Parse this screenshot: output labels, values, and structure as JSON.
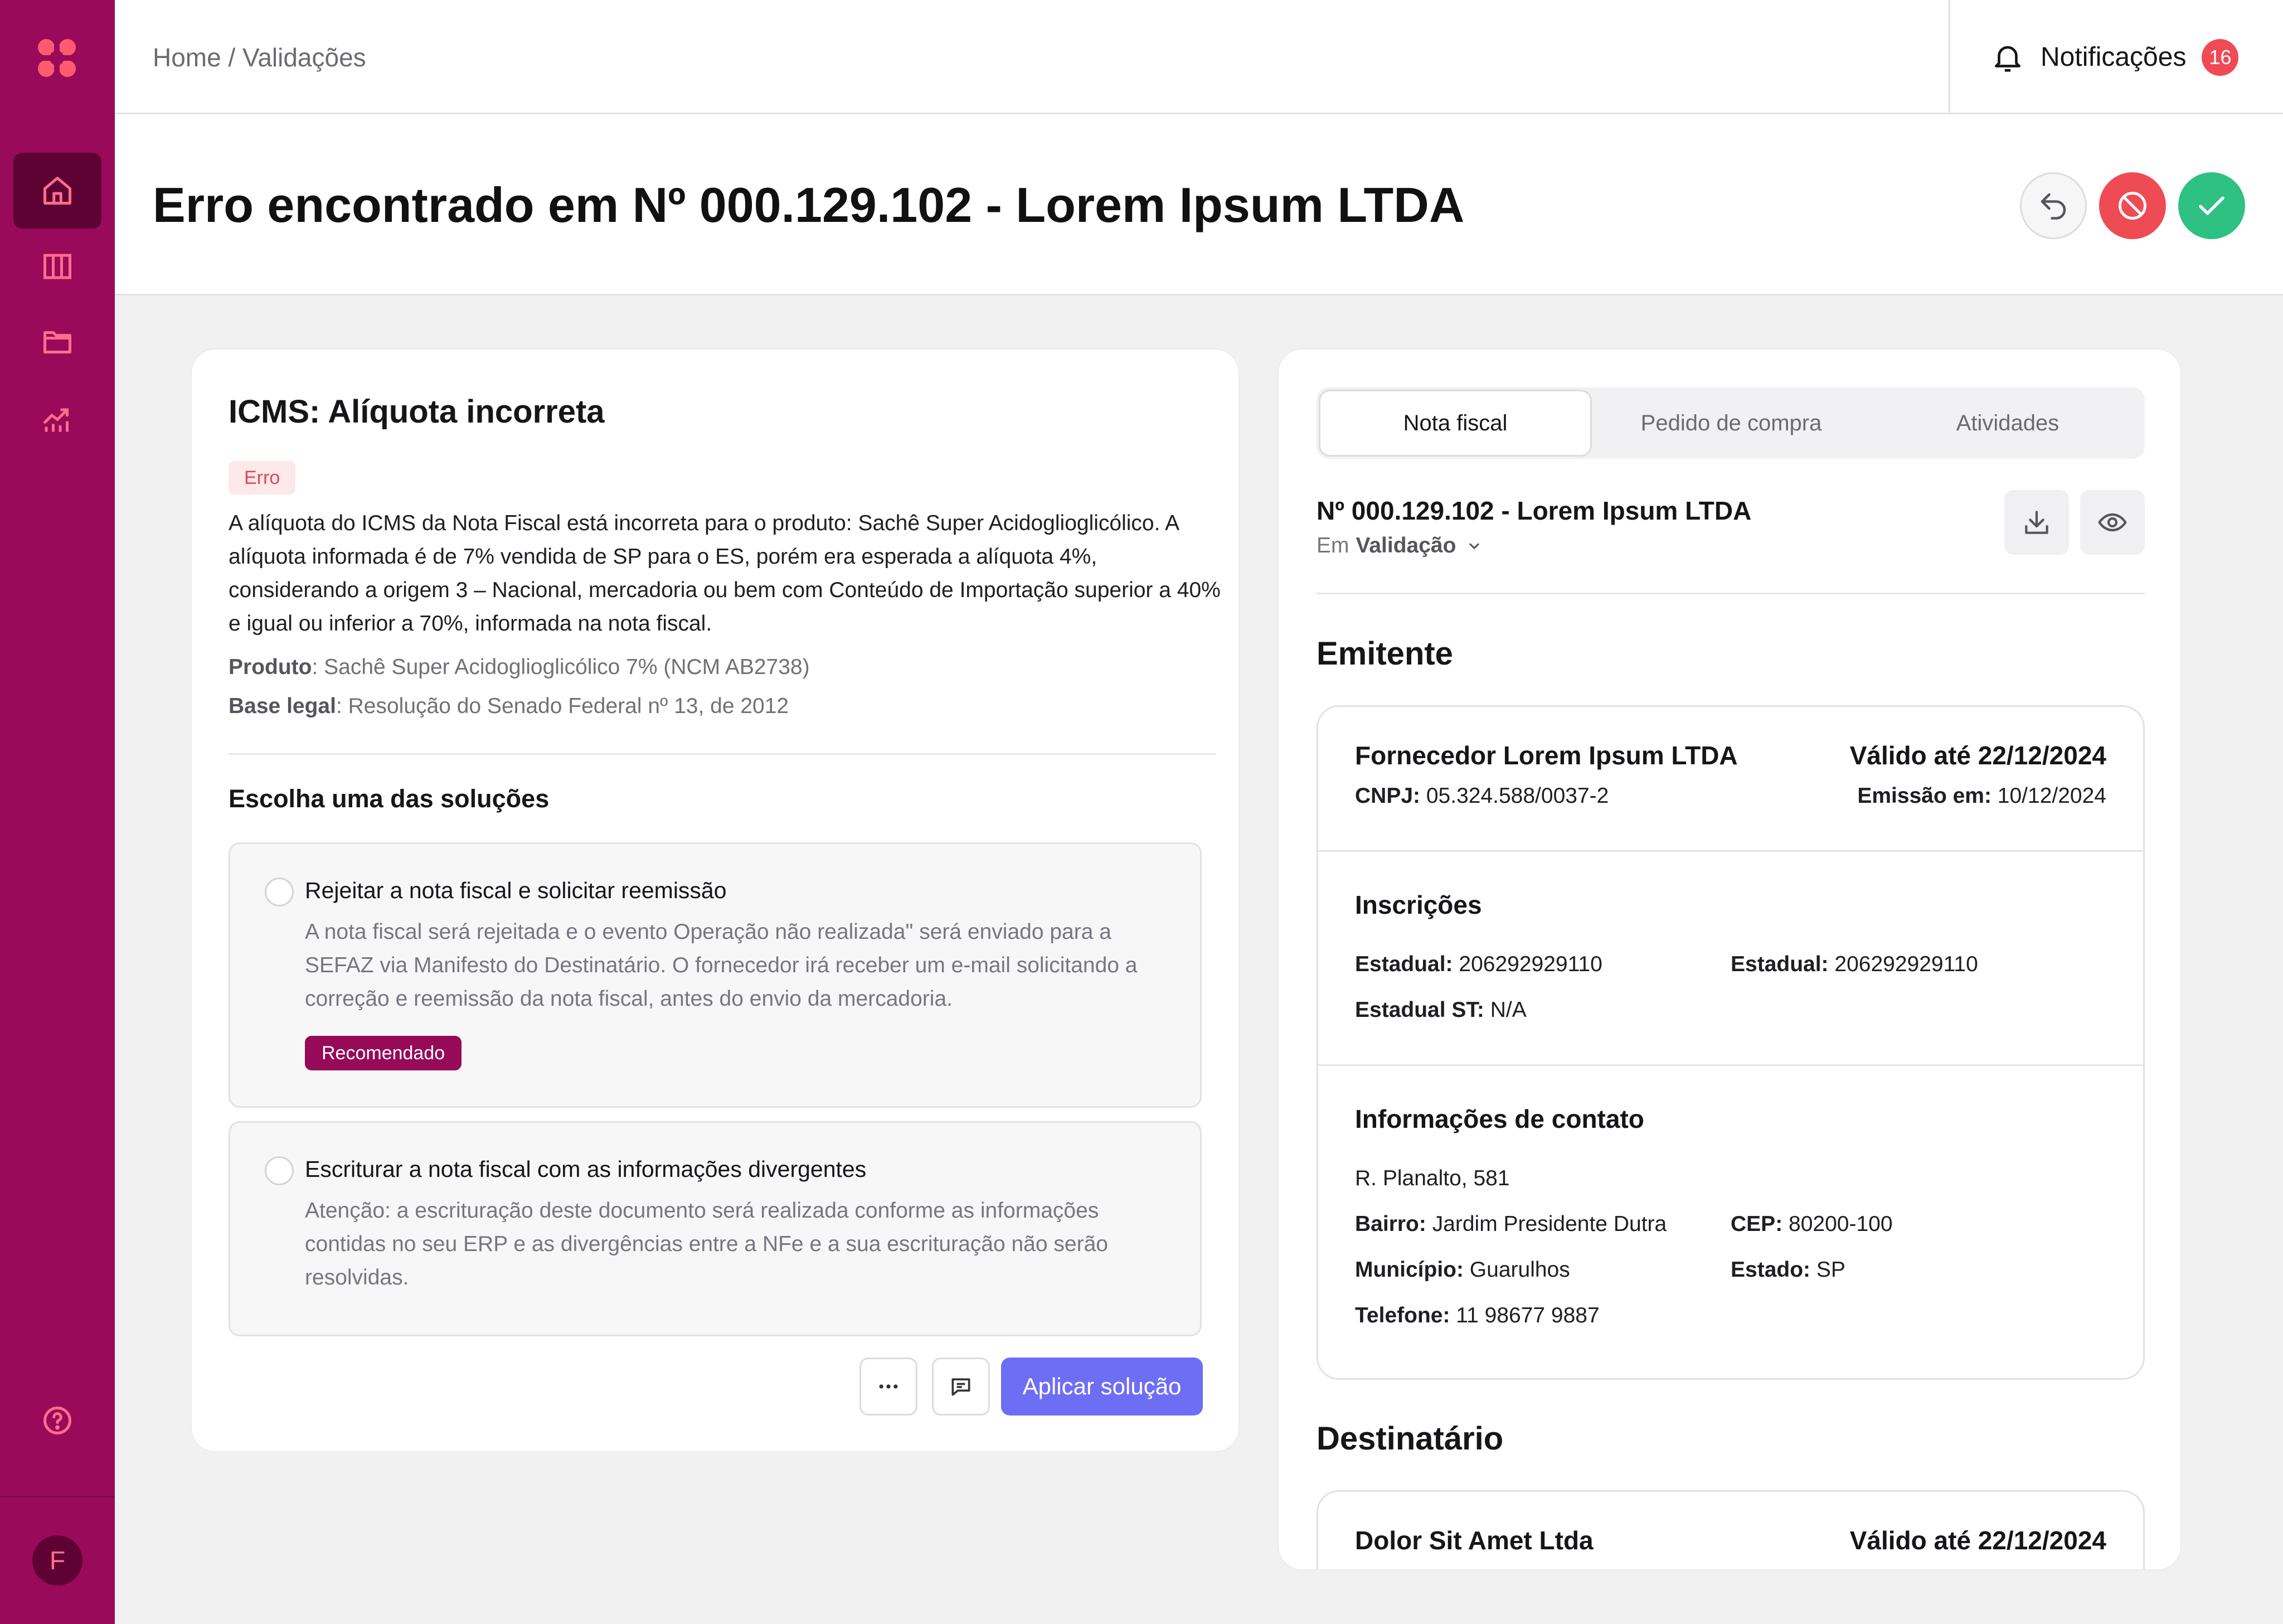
{
  "sidebar": {
    "items": [
      {
        "name": "home",
        "icon": "home-icon",
        "active": true
      },
      {
        "name": "columns",
        "icon": "columns-icon",
        "active": false
      },
      {
        "name": "folder",
        "icon": "folder-icon",
        "active": false
      },
      {
        "name": "analytics",
        "icon": "chart-icon",
        "active": false
      }
    ],
    "help_icon": "help-circle-icon",
    "avatar_initial": "F"
  },
  "topbar": {
    "breadcrumb": "Home / Validações",
    "notifications_label": "Notificações",
    "notifications_count": "16"
  },
  "header": {
    "title": "Erro encontrado em Nº 000.129.102 - Lorem Ipsum LTDA"
  },
  "error": {
    "title": "ICMS: Alíquota incorreta",
    "badge": "Erro",
    "description": "A alíquota do ICMS da Nota Fiscal está incorreta para o produto:  Sachê Super Acidoglioglicólico. A alíquota informada é de 7% vendida de SP para o ES, porém era esperada a alíquota 4%, considerando a origem 3 – Nacional, mercadoria ou bem com Conteúdo de Importação superior a 40% e igual ou inferior a 70%, informada na nota fiscal.",
    "product_label": "Produto",
    "product_value": ": Sachê Super Acidoglioglicólico 7% (NCM AB2738)",
    "legal_label": "Base legal",
    "legal_value": ": Resolução do Senado Federal nº 13, de 2012"
  },
  "solutions": {
    "title": "Escolha uma das soluções",
    "options": [
      {
        "title": "Rejeitar a nota fiscal e solicitar reemissão",
        "description": "A nota fiscal será rejeitada e o evento Operação não realizada\" será enviado para a SEFAZ via Manifesto do Destinatário. O fornecedor irá receber um e-mail solicitando a correção e reemissão da nota fiscal, antes do envio da mercadoria.",
        "badge": "Recomendado"
      },
      {
        "title": "Escriturar a nota fiscal com as informações divergentes",
        "description": "Atenção: a escrituração deste documento será realizada conforme as informações contidas no seu ERP e as divergências entre a NFe e a sua escrituração não serão resolvidas."
      }
    ],
    "apply_label": "Aplicar solução"
  },
  "panel": {
    "tabs": [
      "Nota fiscal",
      "Pedido de compra",
      "Atividades"
    ],
    "invoice_title": "Nº 000.129.102 - Lorem Ipsum LTDA",
    "status_prefix": "Em",
    "status_value": "Validação",
    "emitente_title": "Emitente",
    "supplier_name": "Fornecedor Lorem Ipsum LTDA",
    "valid_until": "Válido até 22/12/2024",
    "cnpj_label": "CNPJ:",
    "cnpj_value": " 05.324.588/0037-2",
    "emission_label": "Emissão em:",
    "emission_value": " 10/12/2024",
    "inscricoes_title": "Inscrições",
    "estadual_label": "Estadual:",
    "estadual_value": " 206292929110",
    "estadual2_label": "Estadual:",
    "estadual2_value": " 206292929110",
    "estadual_st_label": "Estadual ST:",
    "estadual_st_value": " N/A",
    "contato_title": "Informações de contato",
    "address": "R. Planalto, 581",
    "bairro_label": "Bairro:",
    "bairro_value": " Jardim Presidente Dutra",
    "cep_label": "CEP:",
    "cep_value": " 80200-100",
    "municipio_label": "Município:",
    "municipio_value": " Guarulhos",
    "estado_label": "Estado:",
    "estado_value": " SP",
    "telefone_label": "Telefone:",
    "telefone_value": " 11 98677 9887",
    "dest_title": "Destinatário",
    "dest_name": "Dolor Sit Amet Ltda",
    "dest_valid_until": "Válido até 22/12/2024"
  },
  "colors": {
    "brand": "#9a0a5a",
    "accent": "#6e6ef5",
    "danger": "#ef4b55",
    "success": "#2fc083"
  }
}
